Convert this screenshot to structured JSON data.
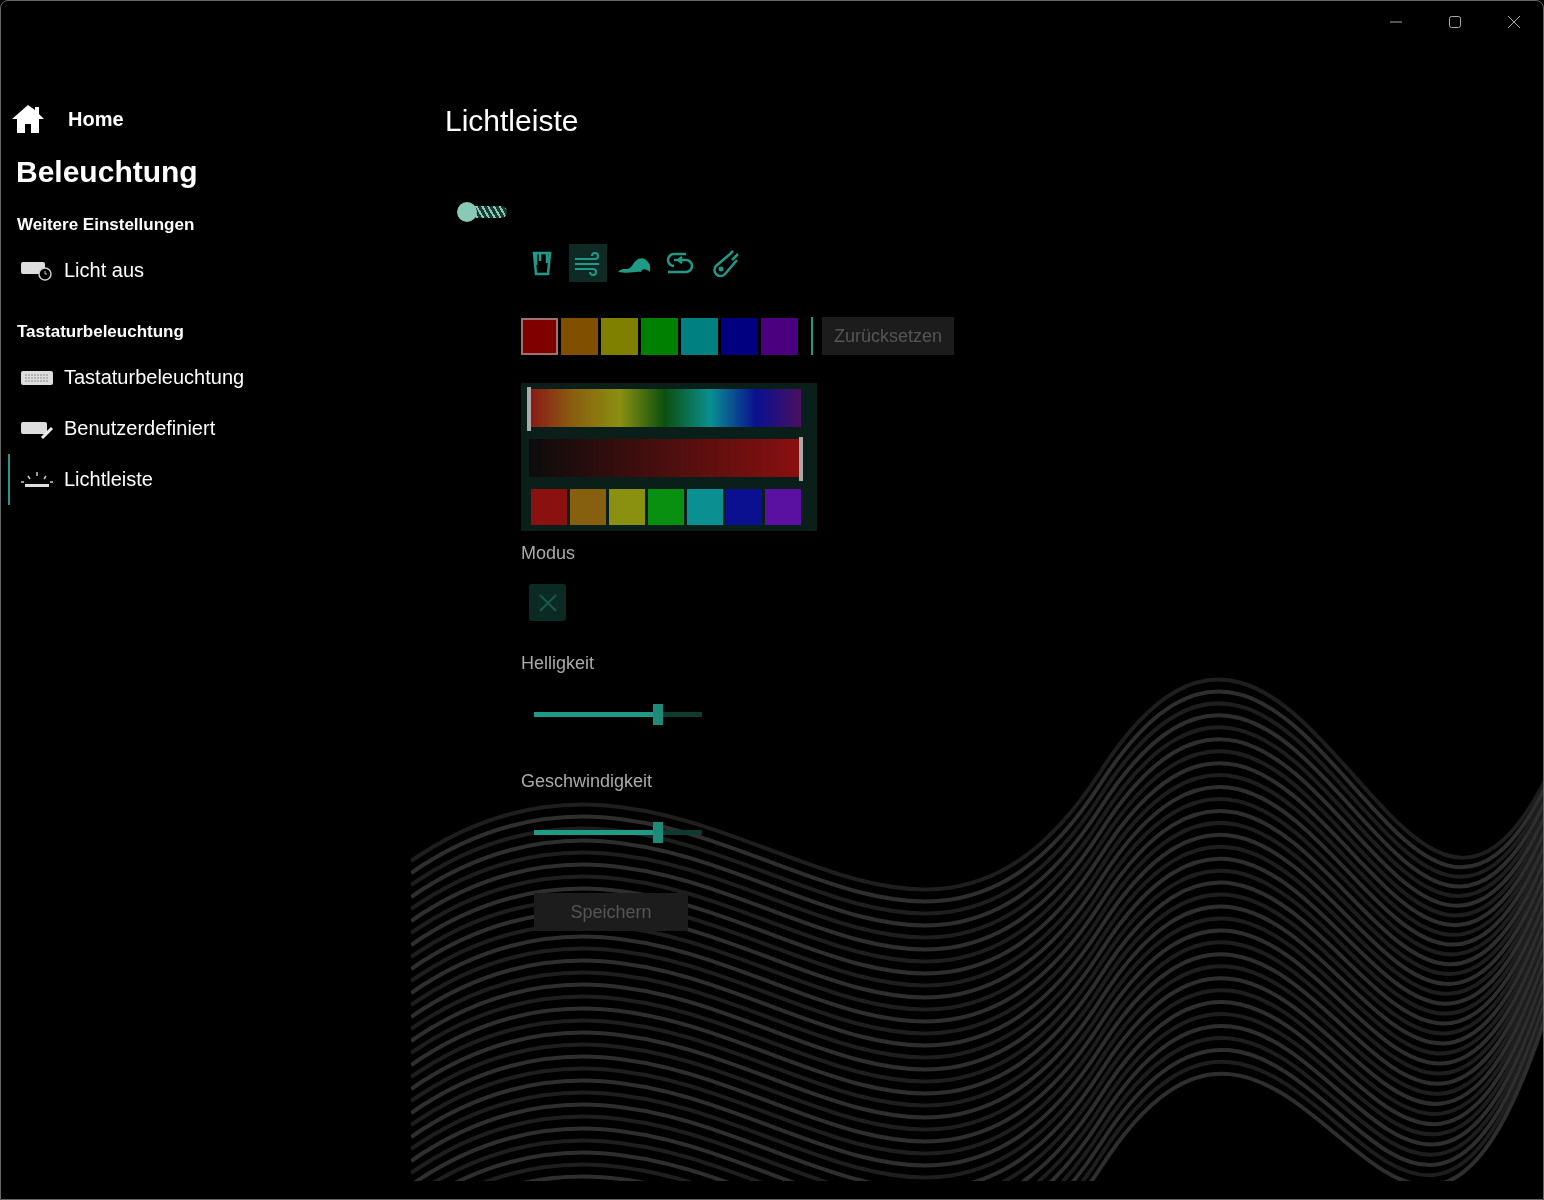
{
  "sidebar": {
    "home": "Home",
    "title": "Beleuchtung",
    "sections": [
      {
        "heading": "Weitere Einstellungen",
        "items": [
          {
            "label": "Licht aus",
            "kind": "timer",
            "selected": false
          }
        ]
      },
      {
        "heading": "Tastaturbeleuchtung",
        "items": [
          {
            "label": "Tastaturbeleuchtung",
            "kind": "keyboard",
            "selected": false
          },
          {
            "label": "Benutzerdefiniert",
            "kind": "custom",
            "selected": false
          },
          {
            "label": "Lichtleiste",
            "kind": "lightbar",
            "selected": true
          }
        ]
      }
    ]
  },
  "page": {
    "title": "Lichtleiste",
    "toggle": {
      "on": false
    },
    "effects": [
      {
        "kind": "paint",
        "selected": false
      },
      {
        "kind": "wind",
        "selected": true
      },
      {
        "kind": "wave",
        "selected": false
      },
      {
        "kind": "loop",
        "selected": false
      },
      {
        "kind": "comet",
        "selected": false
      }
    ],
    "presets": [
      {
        "color": "#800000",
        "selected": true
      },
      {
        "color": "#805000",
        "selected": false
      },
      {
        "color": "#808000",
        "selected": false
      },
      {
        "color": "#008000",
        "selected": false
      },
      {
        "color": "#008080",
        "selected": false
      },
      {
        "color": "#000080",
        "selected": false
      },
      {
        "color": "#4b0080",
        "selected": false
      }
    ],
    "reset": {
      "label": "Zurücksetzen",
      "disabled": true
    },
    "picker": {
      "hue": {
        "level": 0
      },
      "brightness": {
        "level": 1
      },
      "swatches": [
        {
          "color": "#8b1010"
        },
        {
          "color": "#87600f"
        },
        {
          "color": "#8a9010"
        },
        {
          "color": "#0a9010"
        },
        {
          "color": "#0a9090"
        },
        {
          "color": "#0a1090"
        },
        {
          "color": "#5a10a0"
        }
      ]
    },
    "mode_label": "Modus",
    "sliders": [
      {
        "label": "Helligkeit",
        "level": 0.74
      },
      {
        "label": "Geschwindigkeit",
        "level": 0.74
      }
    ],
    "save": {
      "label": "Speichern",
      "disabled": true
    }
  }
}
